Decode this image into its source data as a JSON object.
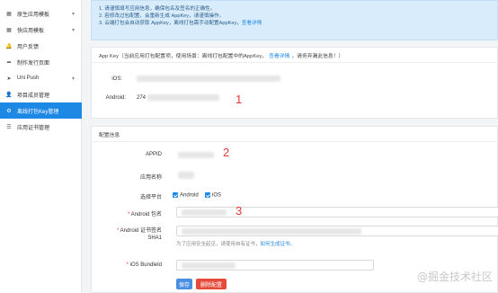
{
  "sidebar": {
    "items": [
      {
        "label": "原生应用模板",
        "icon": "grid-icon",
        "glyph": "▦",
        "has_chevron": true
      },
      {
        "label": "快应用模板",
        "icon": "grid-icon",
        "glyph": "▦",
        "has_chevron": true
      },
      {
        "label": "用户反馈",
        "icon": "bell-icon",
        "glyph": "🔔",
        "has_chevron": false
      },
      {
        "label": "制作发行页面",
        "icon": "share-icon",
        "glyph": "➦",
        "has_chevron": false
      },
      {
        "label": "Uni Push",
        "icon": "paper-plane-icon",
        "glyph": "➤",
        "has_chevron": true
      },
      {
        "label": "项目成员管理",
        "icon": "user-icon",
        "glyph": "👤",
        "has_chevron": false
      },
      {
        "label": "离线打包Key管理",
        "icon": "gear-icon",
        "glyph": "⚙",
        "has_chevron": false,
        "active": true
      },
      {
        "label": "应用证书管理",
        "icon": "list-icon",
        "glyph": "☰",
        "has_chevron": false
      }
    ],
    "chevron": "▾"
  },
  "notice": {
    "line1": "1. 请谨慎填写应用信息，确保包名及签名的正确性。",
    "line2": "2. 若修改过包配置，会重新生成 AppKey，请谨慎操作。",
    "line3_text": "3. 云端打包会自动获取 AppKey，离线打包需手动配置AppKey，",
    "line3_link": "查看详情"
  },
  "appkey": {
    "head_text": "App Key（当前应用打包配置项，使用场景：离线打包配置中的AppKey，",
    "head_link": "查看详情",
    "head_tail": "，请务弃漏此信息！）",
    "ios_label": "iOS:",
    "android_label": "Android:",
    "android_value_prefix": "274"
  },
  "config": {
    "head": "配置信息",
    "appid_label": "APPID",
    "appname_label": "应用名称",
    "platform_label": "选择平台",
    "platform_android": "Android",
    "platform_ios": "iOS",
    "android_pkg_required": "*",
    "android_pkg_label": "Android 包名",
    "android_sha1_required": "*",
    "android_sha1_label_line1": "Android 证书签名",
    "android_sha1_label_line2": "SHA1",
    "sha1_hint": "为了应用安全起见，请使用自有证书，",
    "sha1_hint_link": "如何生成证书。",
    "ios_bundle_required": "*",
    "ios_bundle_label": "iOS BundleId",
    "save_button": "保存",
    "delete_button": "删除配置"
  },
  "annotations": {
    "one": "1",
    "two": "2",
    "three": "3"
  },
  "watermark": "@掘金技术社区",
  "colors": {
    "accent": "#1e88e5",
    "danger": "#e64a3b",
    "annotation": "#e53935"
  }
}
